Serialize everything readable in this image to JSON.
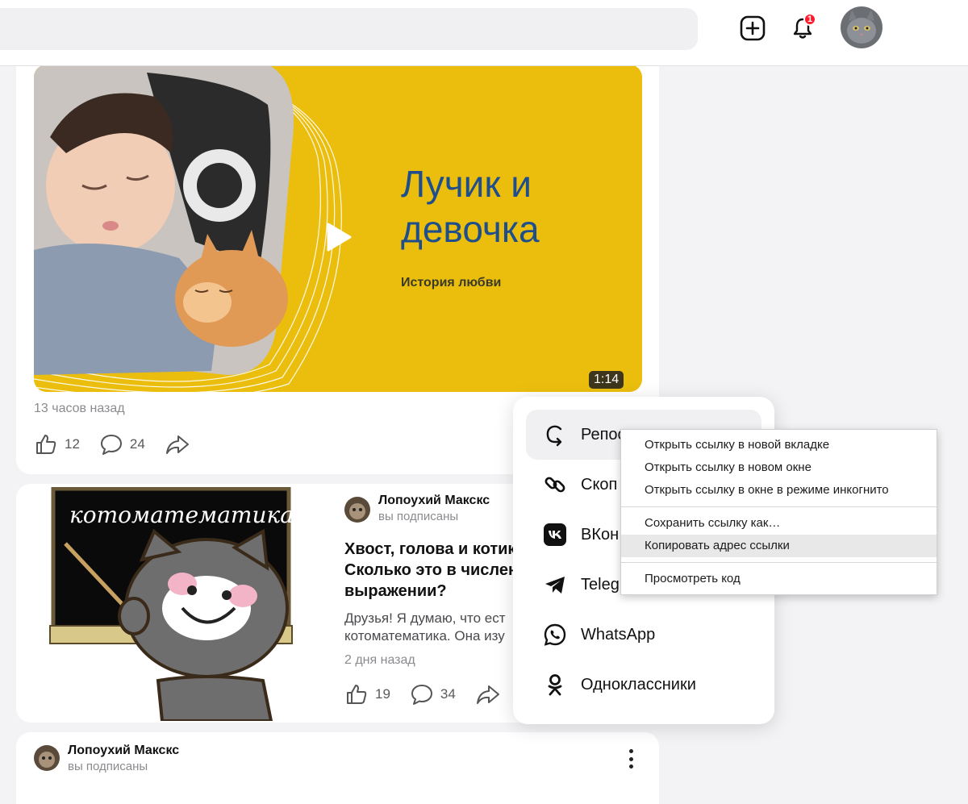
{
  "header": {
    "notification_count": "1"
  },
  "post1": {
    "video_title_line1": "Лучик и",
    "video_title_line2": "девочка",
    "video_subtitle": "История любви",
    "duration": "1:14",
    "time": "13 часов назад",
    "likes": "12",
    "comments": "24"
  },
  "post2": {
    "thumb_text": "котоматематика",
    "author": "Лопоухий Макскс",
    "subscribed": "вы подписаны",
    "title_line1": "Хвост, голова и котик",
    "title_line2": "Сколько это в числен",
    "title_line3": "выражении?",
    "text_line1": "Друзья! Я думаю, что ест",
    "text_line2": "котоматематика. Она изу",
    "time": "2 дня назад",
    "likes": "19",
    "comments": "34"
  },
  "post3": {
    "author": "Лопоухий Макскс",
    "subscribed": "вы подписаны"
  },
  "share_menu": {
    "items": [
      {
        "label": "Репос",
        "icon": "repost-icon"
      },
      {
        "label": "Скоп",
        "icon": "link-icon"
      },
      {
        "label": "ВКон",
        "icon": "vk-icon"
      },
      {
        "label": "Teleg",
        "icon": "telegram-icon"
      },
      {
        "label": "WhatsApp",
        "icon": "whatsapp-icon"
      },
      {
        "label": "Одноклассники",
        "icon": "ok-icon"
      }
    ]
  },
  "context_menu": {
    "open_new_tab": "Открыть ссылку в новой вкладке",
    "open_new_window": "Открыть ссылку в новом окне",
    "open_incognito": "Открыть ссылку в окне в режиме инкогнито",
    "save_link": "Сохранить ссылку как…",
    "copy_link": "Копировать адрес ссылки",
    "inspect": "Просмотреть код"
  },
  "colors": {
    "video_bg": "#ebbe0e",
    "video_title": "#1e4e8c",
    "badge": "#ff1a2e"
  }
}
